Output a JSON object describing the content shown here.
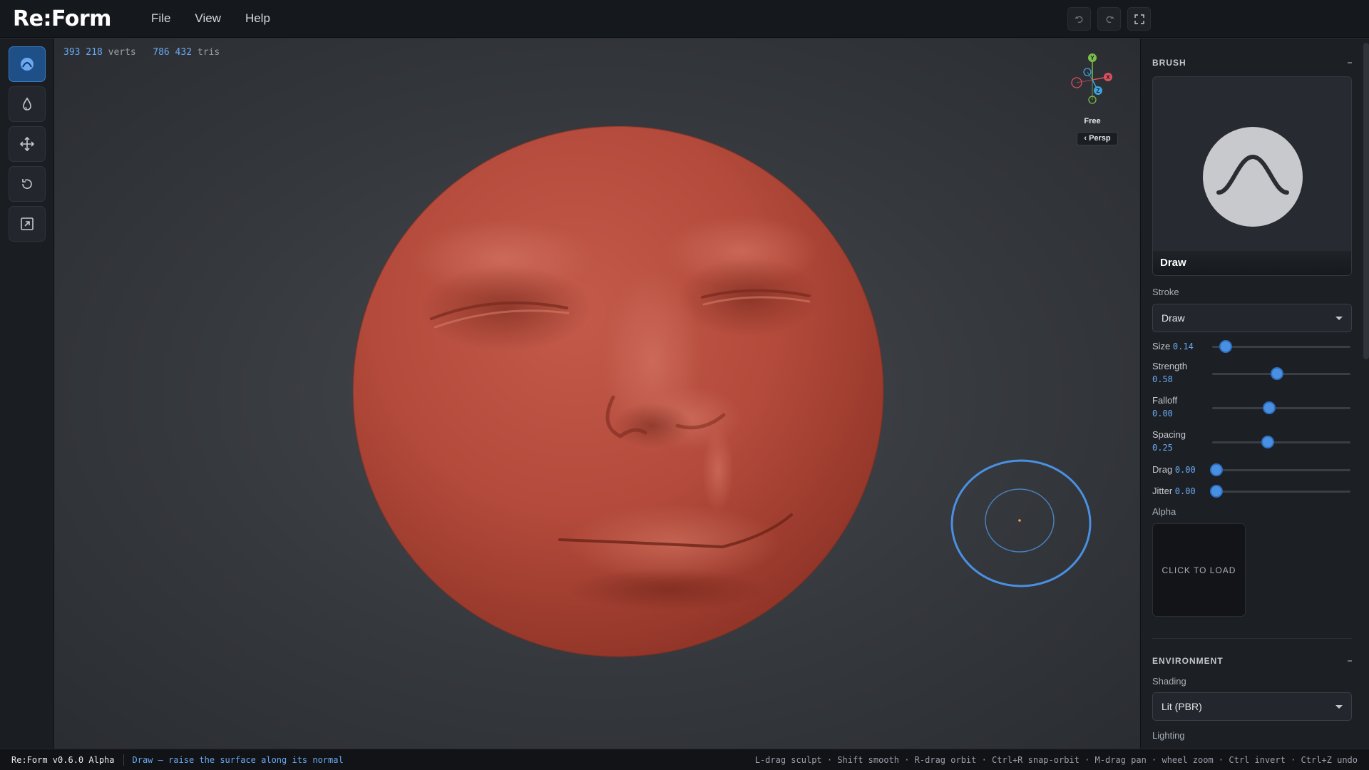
{
  "app": {
    "logo": "Re:Form"
  },
  "menu": [
    "File",
    "View",
    "Help"
  ],
  "top_buttons": [
    "undo-icon",
    "redo-icon",
    "fullscreen-icon"
  ],
  "tools": [
    {
      "name": "brush-draw",
      "icon": "brush-icon",
      "active": true
    },
    {
      "name": "smooth",
      "icon": "drop-icon",
      "active": false
    },
    {
      "name": "move",
      "icon": "move-icon",
      "active": false
    },
    {
      "name": "reset",
      "icon": "reset-icon",
      "active": false
    },
    {
      "name": "export",
      "icon": "export-icon",
      "active": false
    }
  ],
  "stats": {
    "verts": "393 218",
    "verts_label": "verts",
    "tris": "786 432",
    "tris_label": "tris"
  },
  "gizmo": {
    "mode": "Free",
    "projection": "‹ Persp",
    "axes": [
      "Y",
      "X",
      "Z"
    ]
  },
  "brush": {
    "section": "BRUSH",
    "preview_name": "Draw",
    "stroke_label": "Stroke",
    "stroke_value": "Draw",
    "sliders": [
      {
        "label": "Size",
        "value": "0.14",
        "fraction": 0.1,
        "inline": true
      },
      {
        "label": "Strength",
        "value": "0.58",
        "fraction": 0.47,
        "inline": false
      },
      {
        "label": "Falloff",
        "value": "0.00",
        "fraction": 0.41,
        "inline": false
      },
      {
        "label": "Spacing",
        "value": "0.25",
        "fraction": 0.4,
        "inline": false
      },
      {
        "label": "Drag",
        "value": "0.00",
        "fraction": 0.03,
        "inline": true
      },
      {
        "label": "Jitter",
        "value": "0.00",
        "fraction": 0.03,
        "inline": true
      }
    ],
    "alpha_label": "Alpha",
    "alpha_button": "CLICK TO LOAD"
  },
  "environment": {
    "section": "ENVIRONMENT",
    "shading_label": "Shading",
    "shading_value": "Lit (PBR)",
    "lighting_label": "Lighting"
  },
  "status": {
    "version": "Re:Form v0.6.0 Alpha",
    "tip": "Draw — raise the surface along its normal",
    "keys": "L-drag sculpt · Shift smooth · R-drag orbit · Ctrl+R snap-orbit · M-drag pan · wheel zoom · Ctrl invert · Ctrl+Z undo"
  },
  "colors": {
    "accent": "#4a90e2",
    "clay": "#b2483a",
    "background": "#2b2e33"
  }
}
